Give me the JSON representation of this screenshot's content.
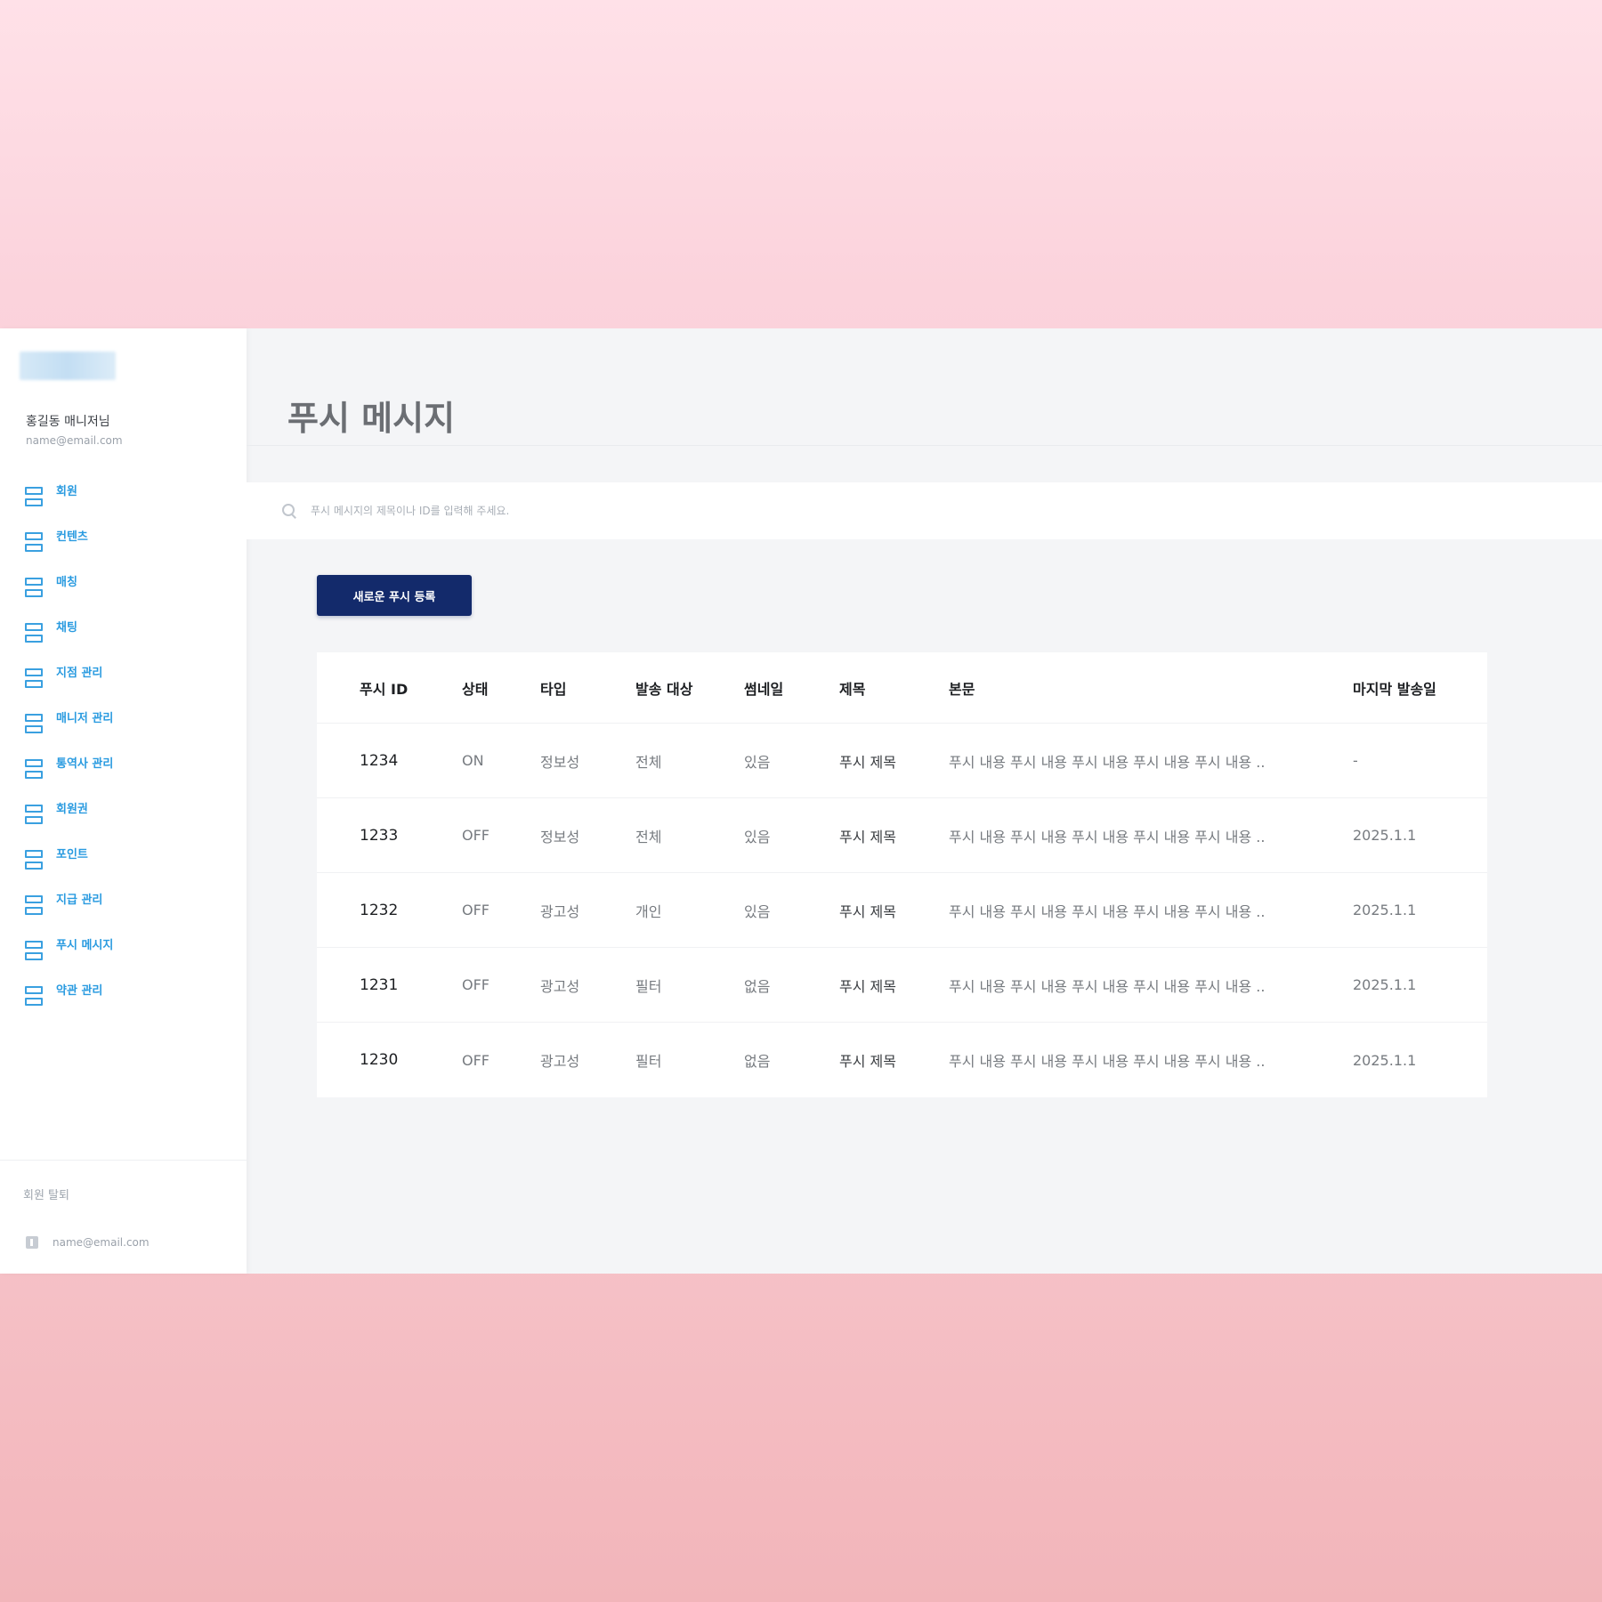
{
  "sidebar": {
    "user_name": "홍길동 매니저님",
    "user_email": "name@email.com",
    "menu": [
      {
        "label": "회원"
      },
      {
        "label": "컨텐츠"
      },
      {
        "label": "매칭"
      },
      {
        "label": "채팅"
      },
      {
        "label": "지점 관리"
      },
      {
        "label": "매니저 관리"
      },
      {
        "label": "통역사 관리"
      },
      {
        "label": "회원권"
      },
      {
        "label": "포인트"
      },
      {
        "label": "지급 관리"
      },
      {
        "label": "푸시 메시지"
      },
      {
        "label": "약관 관리"
      }
    ],
    "withdraw_label": "회원 탈퇴",
    "footer_email": "name@email.com"
  },
  "page": {
    "title": "푸시 메시지"
  },
  "search": {
    "placeholder": "푸시 메시지의 제목이나 ID를 입력해 주세요."
  },
  "toolbar": {
    "new_label": "새로운 푸시 등록"
  },
  "table": {
    "headers": {
      "id": "푸시 ID",
      "status": "상태",
      "type": "타입",
      "target": "발송 대상",
      "thumb": "썸네일",
      "title": "제목",
      "body": "본문",
      "last": "마지막 발송일"
    },
    "rows": [
      {
        "id": "1234",
        "status": "ON",
        "type": "정보성",
        "target": "전체",
        "thumb": "있음",
        "title": "푸시 제목",
        "body": "푸시 내용 푸시 내용 푸시 내용 푸시 내용 푸시 내용 ..",
        "last": "-"
      },
      {
        "id": "1233",
        "status": "OFF",
        "type": "정보성",
        "target": "전체",
        "thumb": "있음",
        "title": "푸시 제목",
        "body": "푸시 내용 푸시 내용 푸시 내용 푸시 내용 푸시 내용 ..",
        "last": "2025.1.1"
      },
      {
        "id": "1232",
        "status": "OFF",
        "type": "광고성",
        "target": "개인",
        "thumb": "있음",
        "title": "푸시 제목",
        "body": "푸시 내용 푸시 내용 푸시 내용 푸시 내용 푸시 내용 ..",
        "last": "2025.1.1"
      },
      {
        "id": "1231",
        "status": "OFF",
        "type": "광고성",
        "target": "필터",
        "thumb": "없음",
        "title": "푸시 제목",
        "body": "푸시 내용 푸시 내용 푸시 내용 푸시 내용 푸시 내용 ..",
        "last": "2025.1.1"
      },
      {
        "id": "1230",
        "status": "OFF",
        "type": "광고성",
        "target": "필터",
        "thumb": "없음",
        "title": "푸시 제목",
        "body": "푸시 내용 푸시 내용 푸시 내용 푸시 내용 푸시 내용 ..",
        "last": "2025.1.1"
      }
    ]
  },
  "colors": {
    "accent": "#132a6b",
    "menu_text": "#2a9be0",
    "background": "#f4f5f7"
  }
}
